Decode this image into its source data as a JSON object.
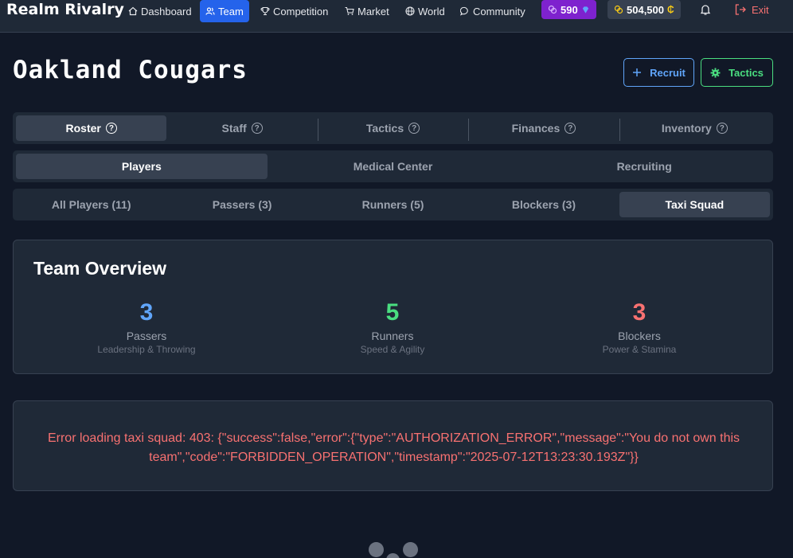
{
  "brand": "Realm Rivalry",
  "nav": {
    "dashboard": "Dashboard",
    "team": "Team",
    "competition": "Competition",
    "market": "Market",
    "world": "World",
    "community": "Community",
    "gems": "590",
    "credits": "504,500",
    "exit": "Exit"
  },
  "header": {
    "team_name": "Oakland Cougars",
    "recruit_label": "Recruit",
    "tactics_label": "Tactics"
  },
  "main_tabs": [
    "Roster",
    "Staff",
    "Tactics",
    "Finances",
    "Inventory"
  ],
  "sub_tabs": [
    "Players",
    "Medical Center",
    "Recruiting"
  ],
  "filter_tabs": [
    "All Players (11)",
    "Passers (3)",
    "Runners (5)",
    "Blockers (3)",
    "Taxi Squad"
  ],
  "overview": {
    "title": "Team Overview",
    "stats": [
      {
        "value": "3",
        "label": "Passers",
        "sub": "Leadership & Throwing",
        "color": "#60a5fa"
      },
      {
        "value": "5",
        "label": "Runners",
        "sub": "Speed & Agility",
        "color": "#4ade80"
      },
      {
        "value": "3",
        "label": "Blockers",
        "sub": "Power & Stamina",
        "color": "#f87171"
      }
    ]
  },
  "error": {
    "message": "Error loading taxi squad: 403: {\"success\":false,\"error\":{\"type\":\"AUTHORIZATION_ERROR\",\"message\":\"You do not own this team\",\"code\":\"FORBIDDEN_OPERATION\",\"timestamp\":\"2025-07-12T13:23:30.193Z\"}}"
  },
  "colors": {
    "accent": "#2563eb",
    "gem_pill": "#7e22ce",
    "error": "#f87171"
  }
}
